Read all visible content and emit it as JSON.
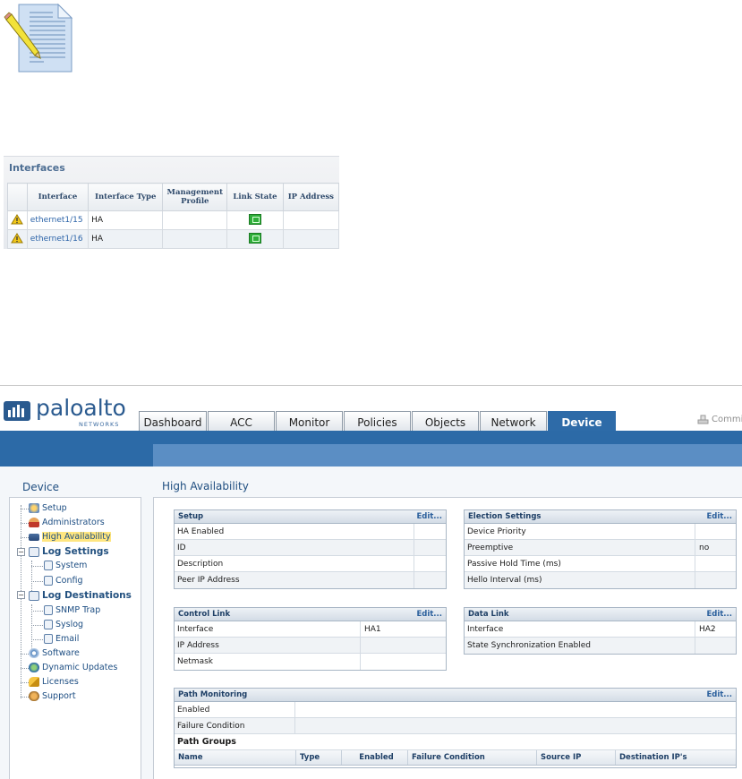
{
  "interfaces": {
    "title": "Interfaces",
    "columns": [
      "",
      "Interface",
      "Interface Type",
      "Management Profile",
      "Link State",
      "IP Address"
    ],
    "rows": [
      {
        "interface": "ethernet1/15",
        "type": "HA",
        "profile": "",
        "link_state": "up",
        "ip": ""
      },
      {
        "interface": "ethernet1/16",
        "type": "HA",
        "profile": "",
        "link_state": "up",
        "ip": ""
      }
    ]
  },
  "brand": {
    "name": "paloalto",
    "sub": "NETWORKS"
  },
  "tabs": [
    "Dashboard",
    "ACC",
    "Monitor",
    "Policies",
    "Objects",
    "Network",
    "Device"
  ],
  "active_tab": "Device",
  "commit_label": "Commit",
  "sidebar": {
    "title": "Device",
    "items": [
      {
        "label": "Setup"
      },
      {
        "label": "Administrators"
      },
      {
        "label": "High Availability"
      },
      {
        "label": "Log Settings"
      },
      {
        "label": "System"
      },
      {
        "label": "Config"
      },
      {
        "label": "Log Destinations"
      },
      {
        "label": "SNMP Trap"
      },
      {
        "label": "Syslog"
      },
      {
        "label": "Email"
      },
      {
        "label": "Software"
      },
      {
        "label": "Dynamic Updates"
      },
      {
        "label": "Licenses"
      },
      {
        "label": "Support"
      }
    ]
  },
  "main": {
    "title": "High Availability",
    "setup": {
      "title": "Setup",
      "edit": "Edit...",
      "rows": [
        {
          "k": "HA Enabled",
          "v": ""
        },
        {
          "k": "ID",
          "v": ""
        },
        {
          "k": "Description",
          "v": ""
        },
        {
          "k": "Peer IP Address",
          "v": ""
        }
      ]
    },
    "election": {
      "title": "Election Settings",
      "edit": "Edit...",
      "rows": [
        {
          "k": "Device Priority",
          "v": ""
        },
        {
          "k": "Preemptive",
          "v": "no"
        },
        {
          "k": "Passive Hold Time (ms)",
          "v": ""
        },
        {
          "k": "Hello Interval (ms)",
          "v": ""
        }
      ]
    },
    "control": {
      "title": "Control Link",
      "edit": "Edit...",
      "rows": [
        {
          "k": "Interface",
          "v": "HA1"
        },
        {
          "k": "IP Address",
          "v": ""
        },
        {
          "k": "Netmask",
          "v": ""
        }
      ]
    },
    "data": {
      "title": "Data Link",
      "edit": "Edit...",
      "rows": [
        {
          "k": "Interface",
          "v": "HA2"
        },
        {
          "k": "State Synchronization Enabled",
          "v": ""
        }
      ]
    },
    "path": {
      "title": "Path Monitoring",
      "edit": "Edit...",
      "rows": [
        {
          "k": "Enabled",
          "v": ""
        },
        {
          "k": "Failure Condition",
          "v": ""
        }
      ],
      "groups_label": "Path Groups",
      "columns": [
        "Name",
        "Type",
        "Enabled",
        "Failure Condition",
        "Source IP",
        "Destination IP's"
      ]
    }
  },
  "colors": {
    "accent": "#2c6aa7",
    "selected": "#ffe680"
  }
}
